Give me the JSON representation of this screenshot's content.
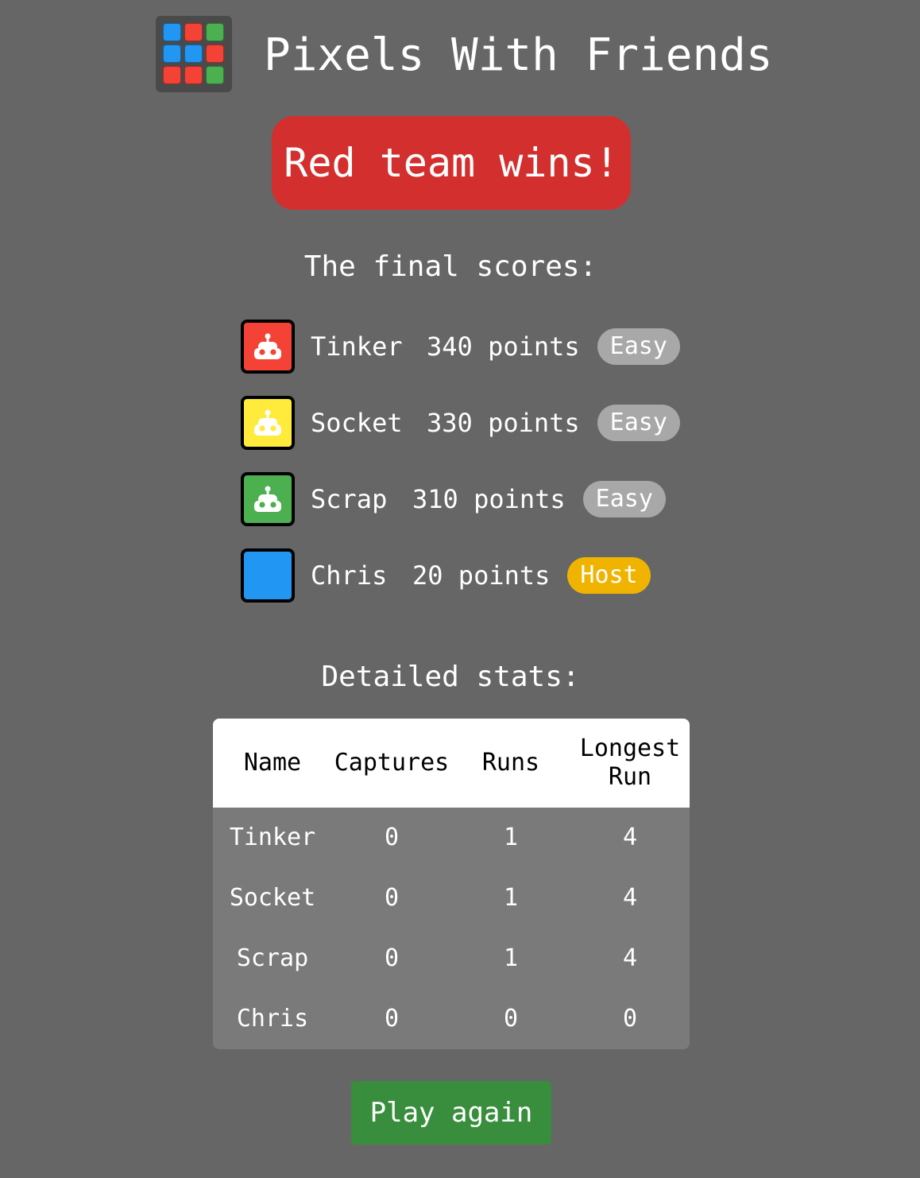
{
  "app": {
    "title": "Pixels With Friends",
    "logo_cells": [
      "#2196f3",
      "#f44336",
      "#4caf50",
      "#2196f3",
      "#2196f3",
      "#f44336",
      "#f44336",
      "#f44336",
      "#4caf50"
    ]
  },
  "result": {
    "message": "Red team wins!",
    "color": "#d32f2f"
  },
  "scores": {
    "heading": "The final scores:",
    "players": [
      {
        "name": "Tinker",
        "points": "340 points",
        "badge": "Easy",
        "badge_type": "difficulty",
        "color": "#f44336",
        "icon": "robot-icon"
      },
      {
        "name": "Socket",
        "points": "330 points",
        "badge": "Easy",
        "badge_type": "difficulty",
        "color": "#ffeb3b",
        "icon": "robot-icon"
      },
      {
        "name": "Scrap",
        "points": "310 points",
        "badge": "Easy",
        "badge_type": "difficulty",
        "color": "#4caf50",
        "icon": "robot-icon"
      },
      {
        "name": "Chris",
        "points": "20 points",
        "badge": "Host",
        "badge_type": "host",
        "color": "#2196f3",
        "icon": ""
      }
    ]
  },
  "stats": {
    "heading": "Detailed stats:",
    "columns": [
      "Name",
      "Captures",
      "Runs",
      "Longest Run"
    ],
    "rows": [
      [
        "Tinker",
        "0",
        "1",
        "4"
      ],
      [
        "Socket",
        "0",
        "1",
        "4"
      ],
      [
        "Scrap",
        "0",
        "1",
        "4"
      ],
      [
        "Chris",
        "0",
        "0",
        "0"
      ]
    ]
  },
  "actions": {
    "play_again": "Play again",
    "play_again_color": "#388e3c"
  },
  "badge_colors": {
    "difficulty": "#a8a8a8",
    "host": "#f0b400"
  }
}
